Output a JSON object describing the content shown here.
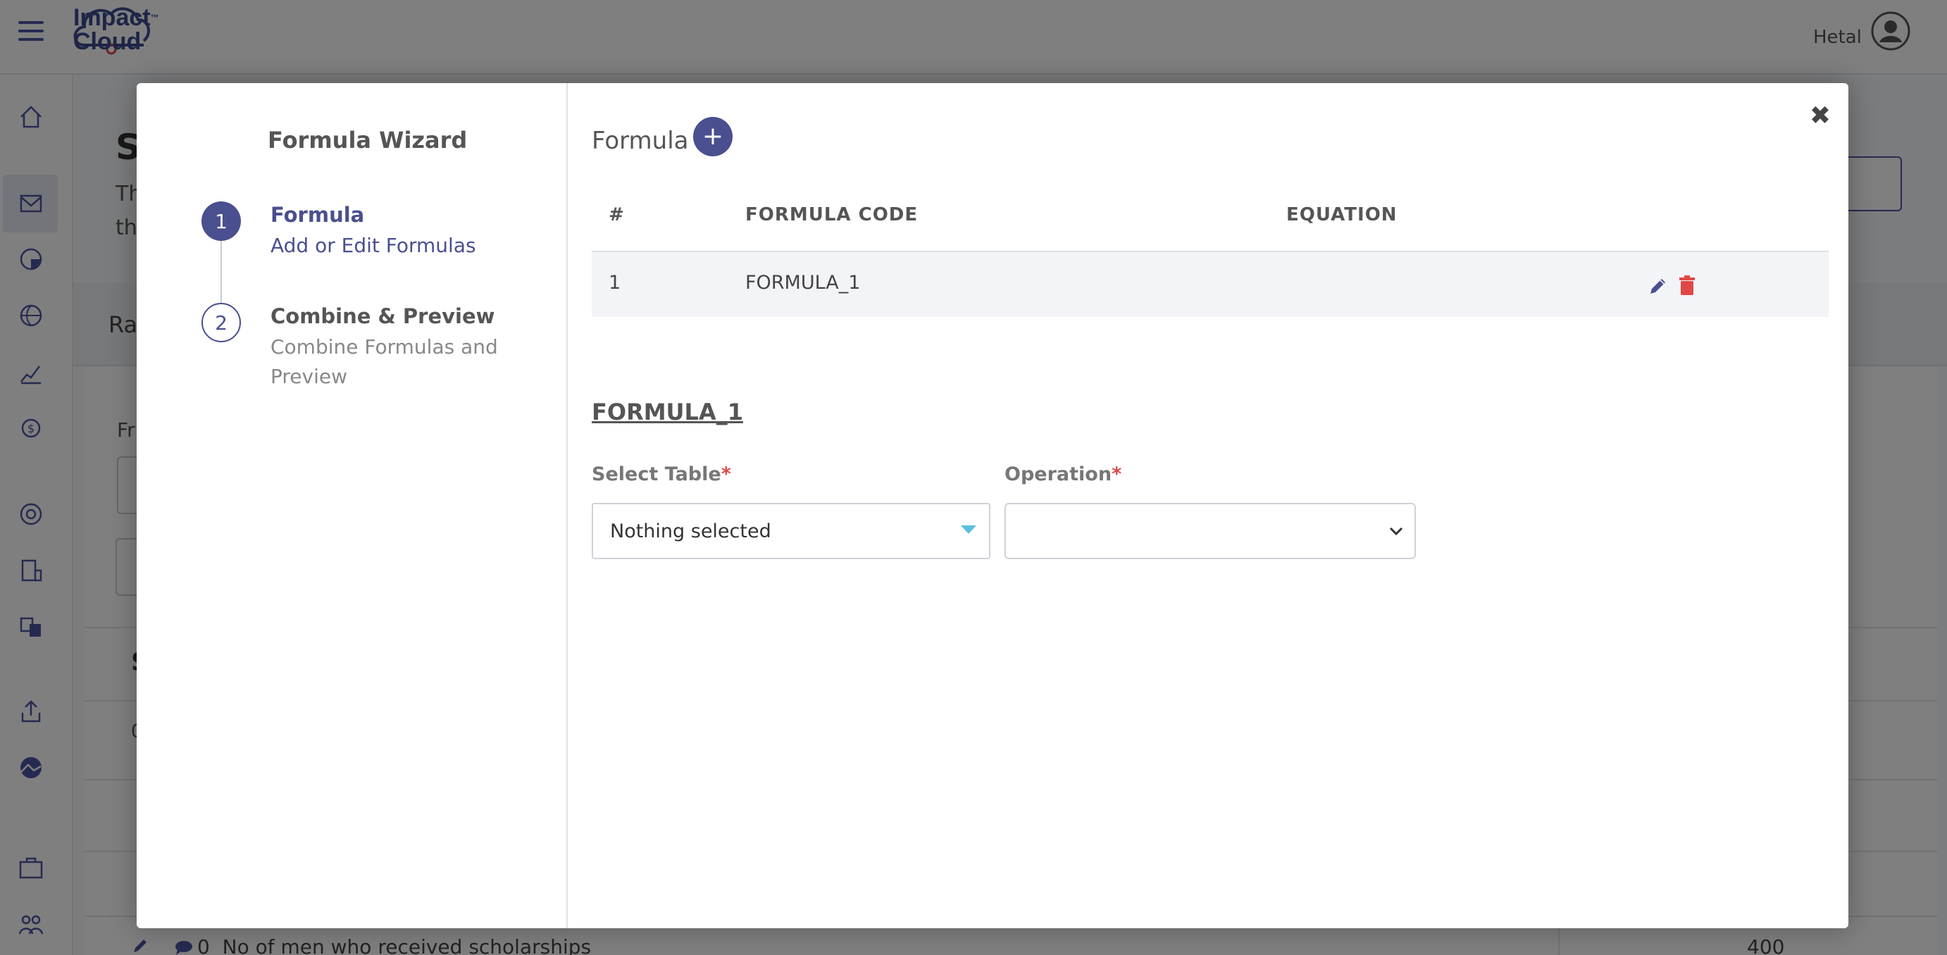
{
  "app": {
    "logo_line1": "Impact",
    "logo_tm": "™",
    "logo_line2": "Cloud",
    "user_name": "Hetal"
  },
  "background": {
    "heading_fragment": "S",
    "sub1_fragment": "Th",
    "sub2_fragment": "th",
    "tab_fragment": "Ra",
    "label_fragment": "Fr",
    "row_letter": "S",
    "row_letter2": "0",
    "bottom_row_count": "0",
    "bottom_row_text": "No of men who received scholarships",
    "bottom_row_value": "400"
  },
  "wizard": {
    "title": "Formula Wizard",
    "steps": [
      {
        "number": "1",
        "title": "Formula",
        "description": "Add or Edit Formulas"
      },
      {
        "number": "2",
        "title": "Combine & Preview",
        "description": "Combine Formulas and Preview"
      }
    ]
  },
  "formula_section": {
    "title": "Formula",
    "add_label": "+",
    "close_label": "✖",
    "table": {
      "headers": [
        "#",
        "FORMULA CODE",
        "EQUATION"
      ],
      "rows": [
        {
          "index": "1",
          "code": "FORMULA_1",
          "equation": ""
        }
      ]
    },
    "current_formula": "FORMULA_1",
    "select_table_label": "Select Table",
    "select_table_value": "Nothing selected",
    "operation_label": "Operation",
    "operation_value": "",
    "required_mark": "*"
  },
  "colors": {
    "primary": "#4a4f8f",
    "delete": "#e04848",
    "caret": "#5bc0de"
  }
}
